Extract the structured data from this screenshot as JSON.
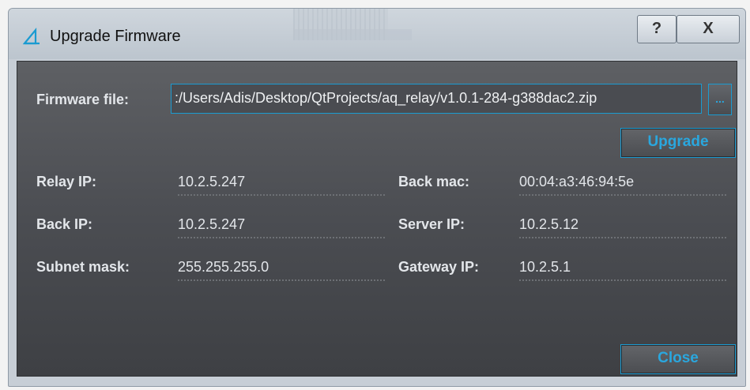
{
  "window": {
    "title": "Upgrade Firmware",
    "help_label": "?",
    "close_label": "X"
  },
  "firmware": {
    "label": "Firmware file:",
    "value": ":/Users/Adis/Desktop/QtProjects/aq_relay/v1.0.1-284-g388dac2.zip",
    "browse_label": "...",
    "upgrade_label": "Upgrade"
  },
  "info": {
    "relay_ip_label": "Relay IP:",
    "relay_ip": "10.2.5.247",
    "back_ip_label": "Back IP:",
    "back_ip": "10.2.5.247",
    "subnet_mask_label": "Subnet mask:",
    "subnet_mask": "255.255.255.0",
    "back_mac_label": "Back mac:",
    "back_mac": "00:04:a3:46:94:5e",
    "server_ip_label": "Server IP:",
    "server_ip": "10.2.5.12",
    "gateway_ip_label": "Gateway IP:",
    "gateway_ip": "10.2.5.1"
  },
  "footer": {
    "close_label": "Close"
  },
  "colors": {
    "accent": "#1b9bd1",
    "panel": "#4b4d52"
  }
}
